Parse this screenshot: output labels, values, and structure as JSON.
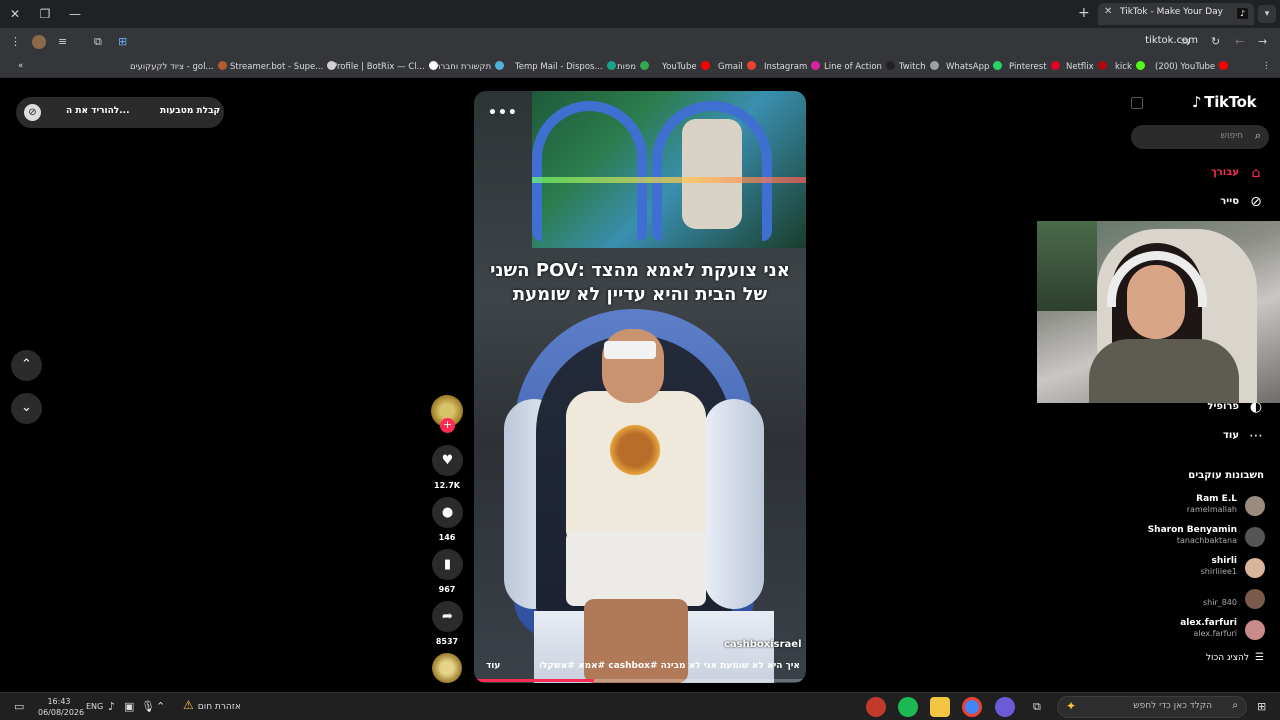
{
  "browser": {
    "tab_title": "TikTok - Make Your Day",
    "url": "tiktok.com",
    "bookmarks": [
      {
        "label": "ציוד לקעקועים - gol...",
        "color": "#b35b2e"
      },
      {
        "label": "Streamer.bot - Supe...",
        "color": "#cfcfcf"
      },
      {
        "label": "Profile | BotRix — Cl...",
        "color": "#ffffff"
      },
      {
        "label": "תקשורת וחברה",
        "color": "#4fb3d9"
      },
      {
        "label": "Temp Mail - Dispos...",
        "color": "#17a589"
      },
      {
        "label": "מפות",
        "color": "#34a853"
      },
      {
        "label": "YouTube",
        "color": "#ff0000"
      },
      {
        "label": "Gmail",
        "color": "#ea4335"
      },
      {
        "label": "Instagram",
        "color": "#d6249f"
      },
      {
        "label": "Line of Action",
        "color": "#222222"
      },
      {
        "label": "Twitch",
        "color": "#9aa0a6"
      },
      {
        "label": "WhatsApp",
        "color": "#25d366"
      },
      {
        "label": "Pinterest",
        "color": "#e60023"
      },
      {
        "label": "Netflix",
        "color": "#b20710"
      },
      {
        "label": "kick",
        "color": "#53fc18"
      },
      {
        "label": "(200) YouTube",
        "color": "#ff0000"
      }
    ]
  },
  "download_pill": {
    "label_a": "להוריד את ה...",
    "label_b": "קבלת מטבעות"
  },
  "video": {
    "caption": "אני צועקת לאמא מהצד :POV השני של הבית והיא עדיין לא שומעת",
    "handle": "cashboxisrael",
    "description": "איך היא לא שומעת אני לא מבינה #cashbox #אמא #אשקלון ...",
    "more_label": "עוד",
    "progress": 0.36
  },
  "actions": {
    "likes": "12.7K",
    "comments": "146",
    "saves": "967",
    "shares": "8537"
  },
  "sidebar": {
    "logo": "TikTok",
    "search_placeholder": "חיפוש",
    "nav": [
      {
        "label": "עבורך",
        "icon": "home-icon",
        "active": true
      },
      {
        "label": "סייר",
        "icon": "compass-icon",
        "active": false
      },
      {
        "label": "פרופיל",
        "icon": "profile-icon",
        "active": false
      },
      {
        "label": "עוד",
        "icon": "more-icon",
        "active": false
      }
    ],
    "following_title": "חשבונות עוקבים",
    "following": [
      {
        "name": "Ram E.L",
        "username": "ramelmallah"
      },
      {
        "name": "Sharon Benyamin",
        "username": "tanachbaktana"
      },
      {
        "name": "shirli",
        "username": "shirliiee1"
      },
      {
        "name": "",
        "username": "shir_840"
      },
      {
        "name": "alex.farfuri",
        "username": "alex.farfuri"
      }
    ],
    "see_all": "להציג הכול"
  },
  "taskbar": {
    "search_placeholder": "הקלד כאן כדי לחפש",
    "weather": "אזהרת חום",
    "language": "ENG",
    "time": "16:43",
    "date": "06/08/2026"
  }
}
